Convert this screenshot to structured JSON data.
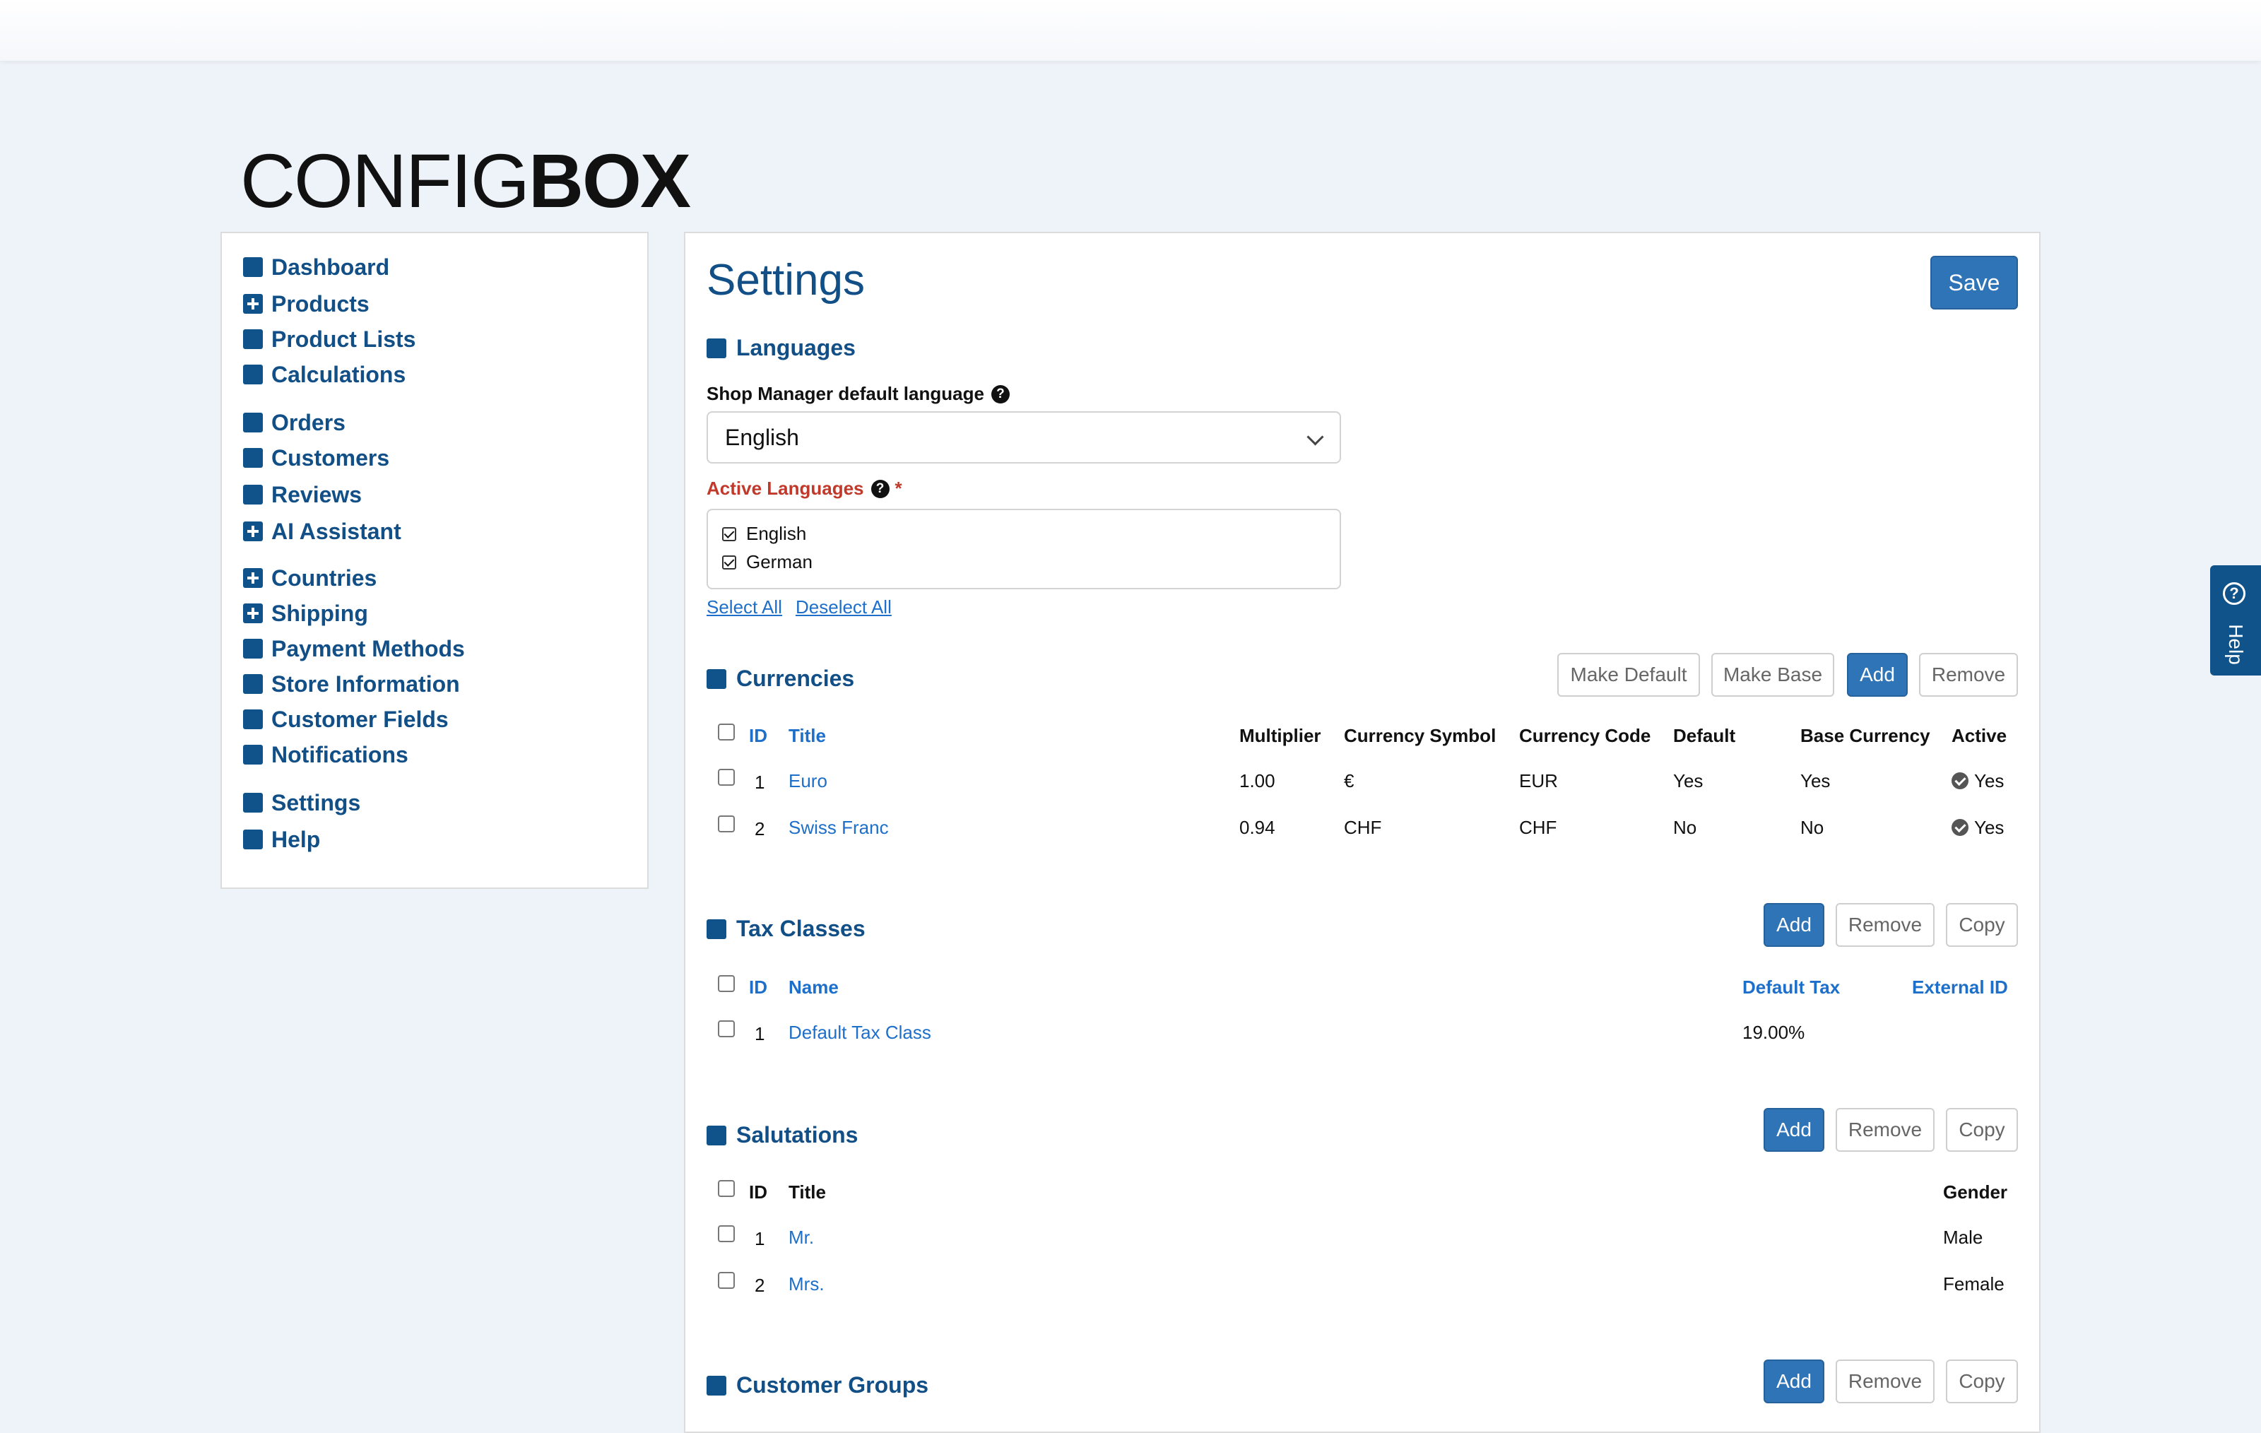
{
  "logo": {
    "light": "CONFIG",
    "bold": "BOX"
  },
  "sidebar": {
    "items": [
      {
        "label": "Dashboard"
      },
      {
        "label": "Products"
      },
      {
        "label": "Product Lists"
      },
      {
        "label": "Calculations"
      },
      {
        "label": "Orders"
      },
      {
        "label": "Customers"
      },
      {
        "label": "Reviews"
      },
      {
        "label": "AI Assistant"
      },
      {
        "label": "Countries"
      },
      {
        "label": "Shipping"
      },
      {
        "label": "Payment Methods"
      },
      {
        "label": "Store Information"
      },
      {
        "label": "Customer Fields"
      },
      {
        "label": "Notifications"
      },
      {
        "label": "Settings"
      },
      {
        "label": "Help"
      }
    ]
  },
  "main": {
    "title": "Settings",
    "save_label": "Save",
    "languages": {
      "heading": "Languages",
      "default_label": "Shop Manager default language",
      "selected": "English",
      "active_label": "Active Languages",
      "required_mark": "*",
      "options": [
        {
          "label": "English",
          "checked": true
        },
        {
          "label": "German",
          "checked": true
        }
      ],
      "select_all": "Select All",
      "deselect_all": "Deselect All"
    },
    "currencies": {
      "heading": "Currencies",
      "buttons": {
        "make_default": "Make Default",
        "make_base": "Make Base",
        "add": "Add",
        "remove": "Remove"
      },
      "columns": {
        "id": "ID",
        "title": "Title",
        "multiplier": "Multiplier",
        "symbol": "Currency Symbol",
        "code": "Currency Code",
        "default": "Default",
        "base": "Base Currency",
        "active": "Active"
      },
      "rows": [
        {
          "id": "1",
          "title": "Euro",
          "multiplier": "1.00",
          "symbol": "€",
          "code": "EUR",
          "default": "Yes",
          "base": "Yes",
          "active": "Yes"
        },
        {
          "id": "2",
          "title": "Swiss Franc",
          "multiplier": "0.94",
          "symbol": "CHF",
          "code": "CHF",
          "default": "No",
          "base": "No",
          "active": "Yes"
        }
      ]
    },
    "tax_classes": {
      "heading": "Tax Classes",
      "buttons": {
        "add": "Add",
        "remove": "Remove",
        "copy": "Copy"
      },
      "columns": {
        "id": "ID",
        "name": "Name",
        "default_tax": "Default Tax",
        "external_id": "External ID"
      },
      "rows": [
        {
          "id": "1",
          "name": "Default Tax Class",
          "default_tax": "19.00%"
        }
      ]
    },
    "salutations": {
      "heading": "Salutations",
      "buttons": {
        "add": "Add",
        "remove": "Remove",
        "copy": "Copy"
      },
      "columns": {
        "id": "ID",
        "title": "Title",
        "gender": "Gender"
      },
      "rows": [
        {
          "id": "1",
          "title": "Mr.",
          "gender": "Male"
        },
        {
          "id": "2",
          "title": "Mrs.",
          "gender": "Female"
        }
      ]
    },
    "customer_groups": {
      "heading": "Customer Groups",
      "buttons": {
        "add": "Add",
        "remove": "Remove",
        "copy": "Copy"
      }
    }
  },
  "help_tab": {
    "label": "Help",
    "icon": "question-circle-icon"
  }
}
